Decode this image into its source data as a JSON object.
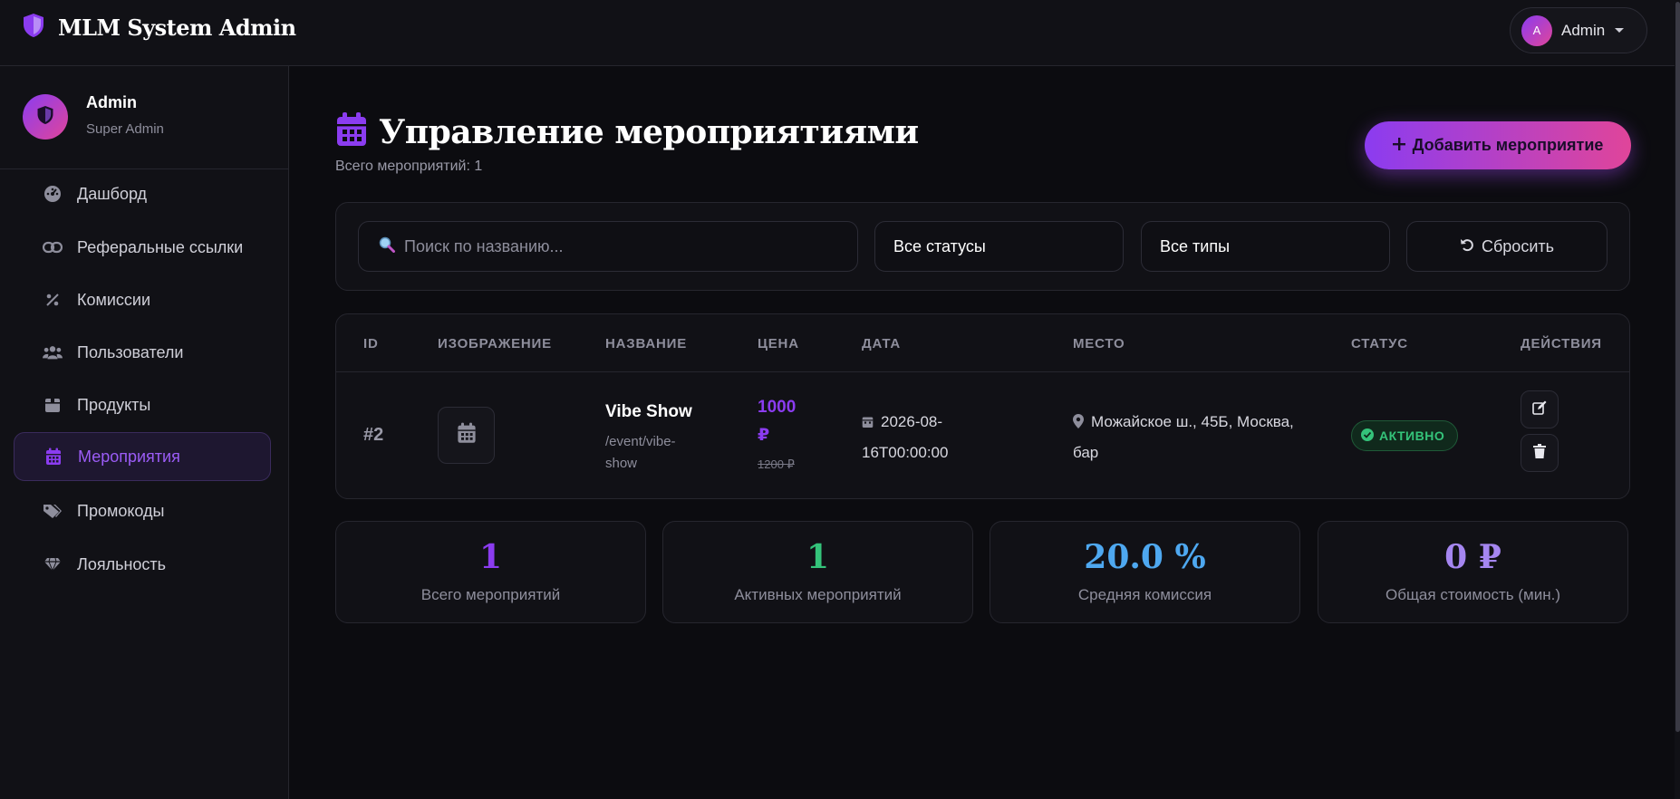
{
  "app": {
    "title": "MLM System Admin",
    "user_name": "Admin",
    "user_initial": "A"
  },
  "sidebar": {
    "profile_name": "Admin",
    "profile_role": "Super Admin",
    "items": [
      {
        "label": "Дашборд",
        "icon": "dashboard-icon"
      },
      {
        "label": "Реферальные ссылки",
        "icon": "link-icon"
      },
      {
        "label": "Комиссии",
        "icon": "percent-icon"
      },
      {
        "label": "Пользователи",
        "icon": "users-icon"
      },
      {
        "label": "Продукты",
        "icon": "box-icon"
      },
      {
        "label": "Мероприятия",
        "icon": "calendar-icon",
        "active": true
      },
      {
        "label": "Промокоды",
        "icon": "tags-icon"
      },
      {
        "label": "Лояльность",
        "icon": "gem-icon"
      }
    ]
  },
  "page": {
    "title": "Управление мероприятиями",
    "subtitle": "Всего мероприятий: 1",
    "add_button": "Добавить мероприятие"
  },
  "filters": {
    "search_placeholder": "Поиск по названию...",
    "status_value": "Все статусы",
    "type_value": "Все типы",
    "reset_label": "Сбросить"
  },
  "table": {
    "columns": [
      "ID",
      "ИЗОБРАЖЕНИЕ",
      "НАЗВАНИЕ",
      "ЦЕНА",
      "ДАТА",
      "МЕСТО",
      "СТАТУС",
      "ДЕЙСТВИЯ"
    ],
    "rows": [
      {
        "id": "#2",
        "name": "Vibe Show",
        "slug": "/event/vibe-show",
        "price": "1000 ₽",
        "old_price": "1200 ₽",
        "date": "2026-08-16T00:00:00",
        "place": "Можайское ш., 45Б, Москва, бар",
        "status": "АКТИВНО"
      }
    ]
  },
  "stats": [
    {
      "value": "1",
      "label": "Всего мероприятий",
      "color": "#8b3cf0"
    },
    {
      "value": "1",
      "label": "Активных мероприятий",
      "color": "#34c37a"
    },
    {
      "value": "20.0 %",
      "label": "Средняя комиссия",
      "color": "#4ea8f0"
    },
    {
      "value": "0 ₽",
      "label": "Общая стоимость (мин.)",
      "color": "#a586f0"
    }
  ],
  "colors": {
    "accent": "#8b3cf0",
    "accent_pink": "#e0459a",
    "success": "#34c37a",
    "background": "#0c0c10",
    "panel": "#111116"
  }
}
